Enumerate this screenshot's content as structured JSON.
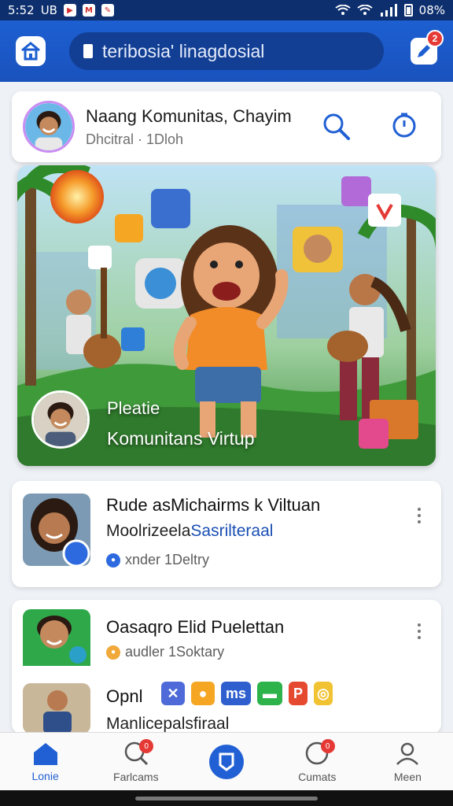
{
  "status_bar": {
    "time": "5:52",
    "carrier": "UB",
    "battery": "08%"
  },
  "header": {
    "search_text": "teribosia' linagdosial",
    "notification_count": "2"
  },
  "profile": {
    "name": "Naang Komunitas, Chayim",
    "meta": "Dhcitral · 1Dloh"
  },
  "banner": {
    "line1": "Pleatie",
    "line2": "Komunitans Virtup"
  },
  "posts": [
    {
      "title": "Rude asMichairms k Viltuan",
      "sub_prefix": "Moolrizeela",
      "sub_accent": "Sasrilteraal",
      "meta": "xnder 1Deltry"
    },
    {
      "title": "Oasaqro Elid Puelettan",
      "meta": "audler 1Soktary",
      "sub_title": "Opnl",
      "sub_body": "Manlicepalsfiraal",
      "apps": [
        "ms",
        "P"
      ]
    }
  ],
  "nav": [
    {
      "label": "Lonie",
      "icon": "home-icon"
    },
    {
      "label": "Farlcams",
      "icon": "search-icon",
      "badge": "0"
    },
    {
      "label": "",
      "icon": "flag-icon"
    },
    {
      "label": "Cumats",
      "icon": "chat-icon",
      "badge": "0"
    },
    {
      "label": "Meen",
      "icon": "profile-icon"
    }
  ],
  "colors": {
    "brand": "#1d5fd1",
    "status_bar": "#0d2f6e",
    "badge": "#e53935"
  }
}
